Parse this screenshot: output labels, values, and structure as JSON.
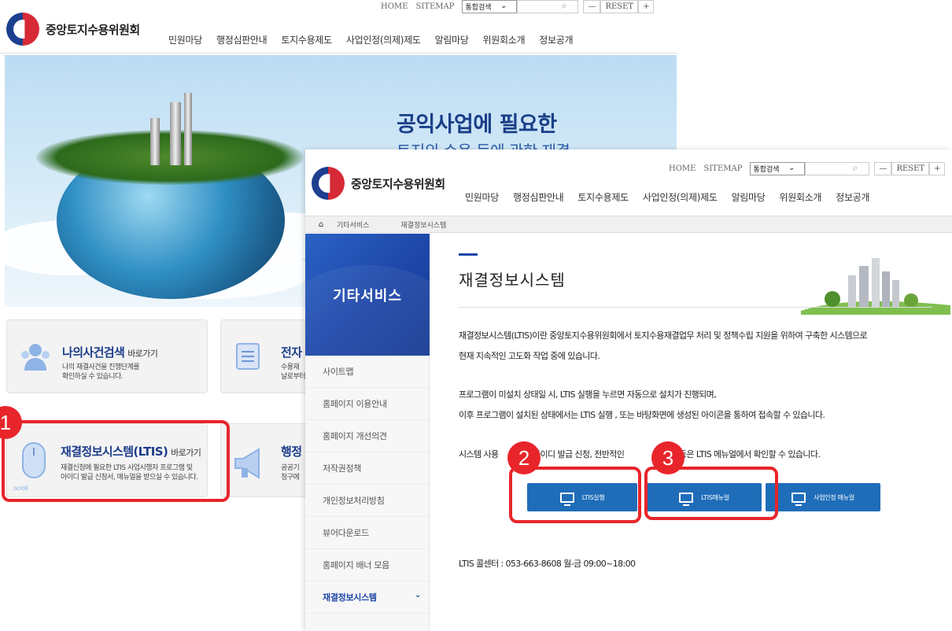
{
  "colors": {
    "accent": "#1d46a8",
    "button": "#1f6db9",
    "highlight": "#e8252b"
  },
  "back_window": {
    "logo_text": "중앙토지수용위원회",
    "util": {
      "home": "HOME",
      "sitemap": "SITEMAP",
      "search_select": "통합검색",
      "reset": "RESET",
      "minus": "—",
      "plus": "+"
    },
    "nav": [
      "민원마당",
      "행정심판안내",
      "토지수용제도",
      "사업인정(의제)제도",
      "알림마당",
      "위원회소개",
      "정보공개"
    ],
    "hero": {
      "title": "공익사업에 필요한",
      "subtitle": "토지의 수용 등에 관한 재결"
    },
    "cards": {
      "case_search": {
        "title": "나의사건검색",
        "link": "바로가기",
        "desc1": "나의 재결사건을 진행단계를",
        "desc2": "확인하실 수 있습니다."
      },
      "electronic": {
        "title": "전자",
        "desc1": "수용재",
        "desc2": "날로부터"
      },
      "ltis": {
        "title": "재결정보시스템(LTIS)",
        "link": "바로가기",
        "desc1": "재결신청에 필요한 LTIS 사업시행자 프로그램 및",
        "desc2": "아이디 발급 신청서, 매뉴얼을 받으실 수 있습니다.",
        "scroll": "scroll"
      },
      "admin": {
        "title": "행정",
        "desc1": "공공기",
        "desc2": "청구에"
      }
    }
  },
  "front_window": {
    "logo_text": "중앙토지수용위원회",
    "util": {
      "home": "HOME",
      "sitemap": "SITEMAP",
      "search_select": "통합검색",
      "reset": "RESET",
      "minus": "—",
      "plus": "+"
    },
    "nav": [
      "민원마당",
      "행정심판안내",
      "토지수용제도",
      "사업인정(의제)제도",
      "알림마당",
      "위원회소개",
      "정보공개"
    ],
    "breadcrumb": [
      "기타서비스",
      "재결정보시스템"
    ],
    "sidebar": {
      "title": "기타서비스",
      "items": [
        "사이트맵",
        "홈페이지 이용안내",
        "홈페이지 개선의견",
        "저작권정책",
        "개인정보처리방침",
        "뷰어다운로드",
        "홈페이지 배너 모음",
        "재결정보시스템"
      ]
    },
    "content": {
      "title": "재결정보시스템",
      "p1_line1": "재결정보시스템(LTIS)이란 중앙토지수용위원회에서 토지수용재결업무 처리 및 정책수립 지원을 위하여 구축한 시스템으로",
      "p1_line2": "현재 지속적인 고도화 작업 중에 있습니다.",
      "p2_line1": "프로그램이 미설치 상태일 시, LTIS 실행을 누르면 자동으로 설치가 진행되며,",
      "p2_line2": "이후 프로그램이 설치된 상태에서는 LTIS 실행 , 또는 바탕화면에 생성된 아이콘을 통하여 접속할 수 있습니다.",
      "p3_a": "시스템 사용",
      "p3_b": "아이디 발급 신청, 전반적인",
      "p3_c": "등은 LTIS 메뉴얼에서 확인할 수 있습니다.",
      "buttons": [
        "LTIS실행",
        "LTIS매뉴얼",
        "사업인정 매뉴얼"
      ],
      "callcenter": "LTIS 콜센터 : 053-663-8608 월-금 09:00~18:00"
    }
  },
  "markers": [
    "1",
    "2",
    "3"
  ]
}
